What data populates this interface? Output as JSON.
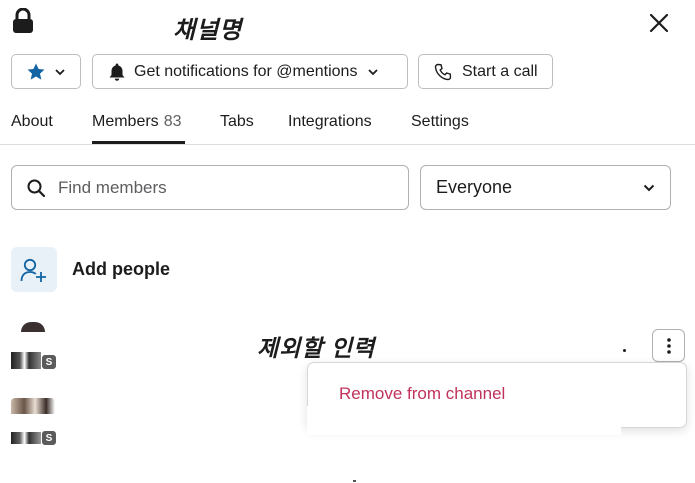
{
  "header": {
    "channel_name": "채널명",
    "close_icon": "close-icon",
    "lock_icon": "lock-icon"
  },
  "toolbar": {
    "star_icon": "star-icon",
    "notifications_label": "Get notifications for @mentions",
    "call_label": "Start a call"
  },
  "tabs": [
    {
      "label": "About"
    },
    {
      "label": "Members",
      "count": "83",
      "active": true
    },
    {
      "label": "Tabs"
    },
    {
      "label": "Integrations"
    },
    {
      "label": "Settings"
    }
  ],
  "search": {
    "placeholder": "Find members",
    "filter_value": "Everyone"
  },
  "add_people": {
    "label": "Add people"
  },
  "annotation": {
    "text": "제외할 인력"
  },
  "member_menu": {
    "remove_label": "Remove from channel"
  },
  "badges": {
    "status_letter": "S"
  },
  "colors": {
    "accent_blue": "#1264a3",
    "danger_text": "#c0325a",
    "add_bg": "#e8f0f8"
  }
}
